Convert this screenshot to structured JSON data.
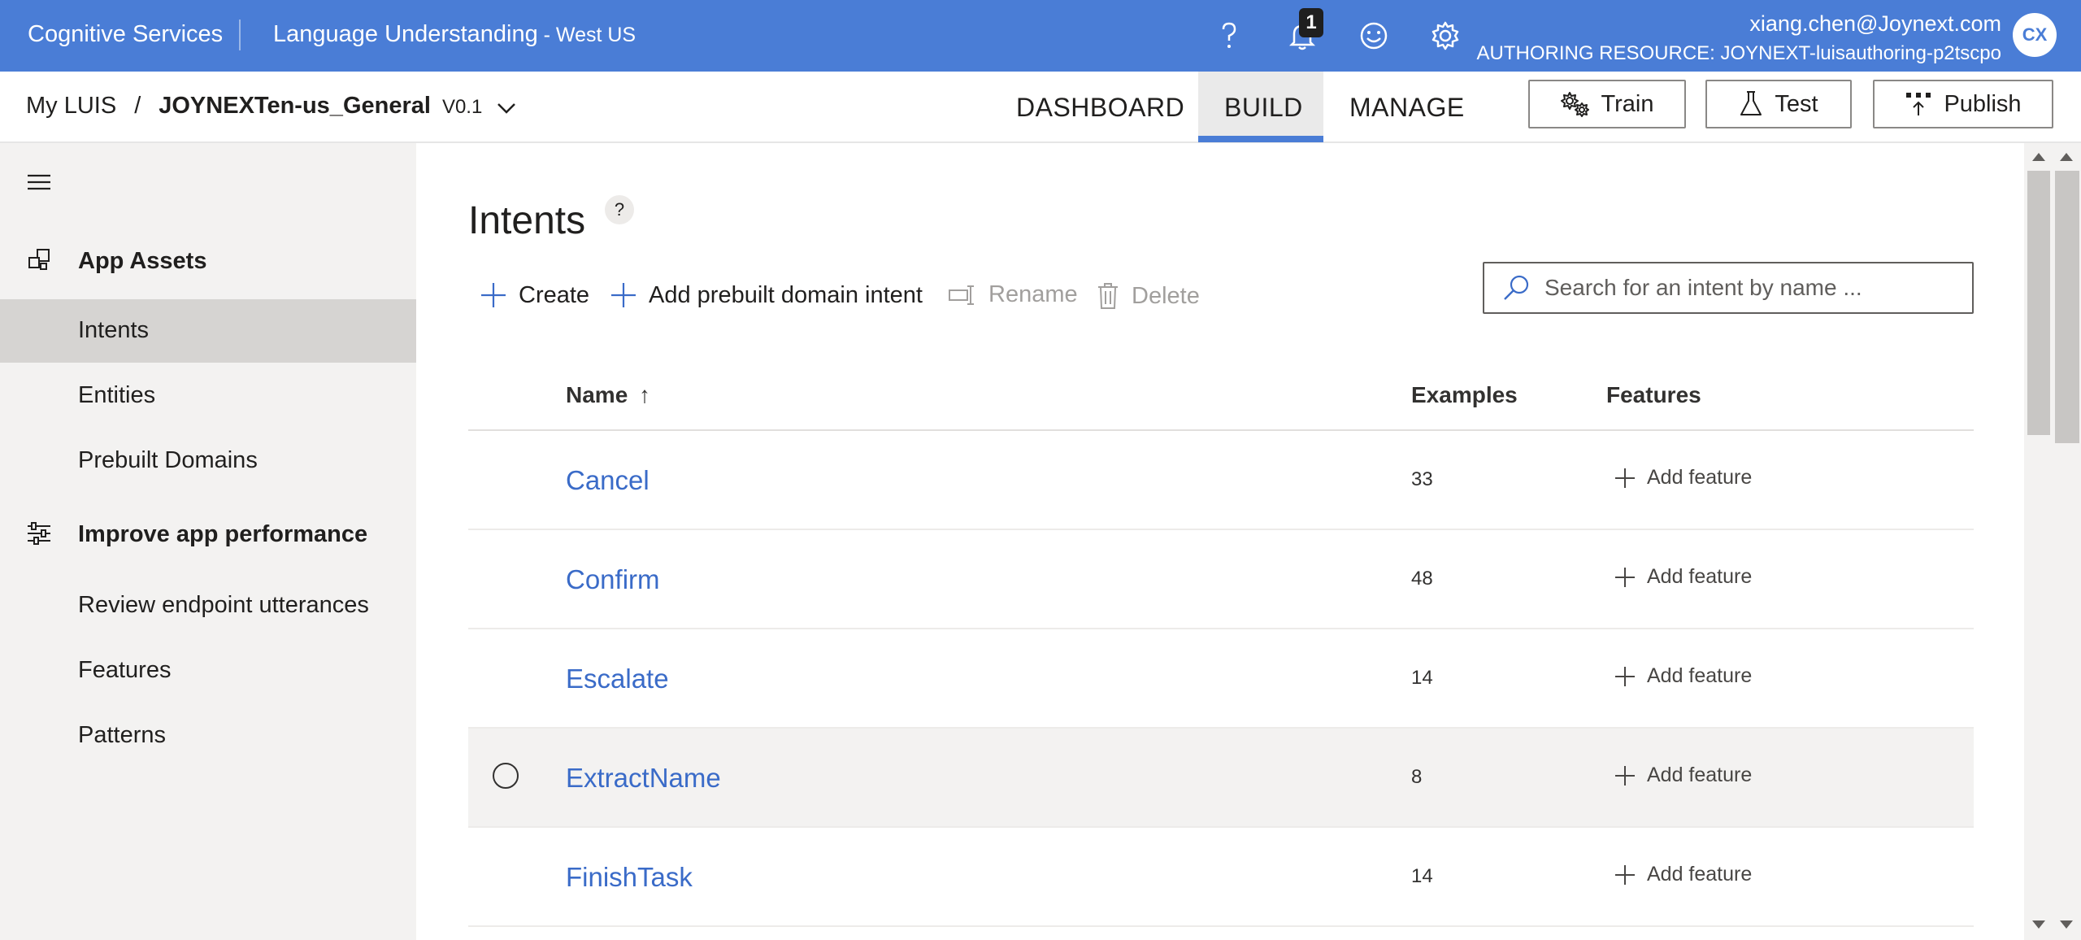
{
  "topbar": {
    "brand": "Cognitive Services",
    "app_name": "Language Understanding",
    "region": " - West US",
    "notification_count": "1",
    "user_email": "xiang.chen@Joynext.com",
    "authoring_resource": "AUTHORING RESOURCE:  JOYNEXT-luisauthoring-p2tscpo",
    "avatar_initials": "CX",
    "icons": [
      "help-icon",
      "bell-icon",
      "feedback-smiley-icon",
      "settings-gear-icon"
    ]
  },
  "subheader": {
    "breadcrumb_root": "My LUIS",
    "breadcrumb_sep": "/",
    "app_selector": "JOYNEXTen-us_General",
    "version": "V0.1",
    "tabs": [
      {
        "label": "DASHBOARD",
        "active": false
      },
      {
        "label": "BUILD",
        "active": true
      },
      {
        "label": "MANAGE",
        "active": false
      }
    ],
    "buttons": {
      "train": "Train",
      "test": "Test",
      "publish": "Publish"
    }
  },
  "sidebar": {
    "sections": [
      {
        "label": "App Assets",
        "icon": "app-assets-icon",
        "items": [
          {
            "label": "Intents",
            "selected": true
          },
          {
            "label": "Entities",
            "selected": false
          },
          {
            "label": "Prebuilt Domains",
            "selected": false
          }
        ]
      },
      {
        "label": "Improve app performance",
        "icon": "sliders-icon",
        "items": [
          {
            "label": "Review endpoint utterances",
            "selected": false
          },
          {
            "label": "Features",
            "selected": false
          },
          {
            "label": "Patterns",
            "selected": false
          }
        ]
      }
    ]
  },
  "main": {
    "title": "Intents",
    "help": "?",
    "toolbar": {
      "create": "Create",
      "add_prebuilt": "Add prebuilt domain intent",
      "rename": "Rename",
      "delete": "Delete"
    },
    "search_placeholder": "Search for an intent by name ...",
    "table": {
      "columns": {
        "name": "Name",
        "sort_indicator": "↑",
        "examples": "Examples",
        "features": "Features"
      },
      "rows": [
        {
          "name": "Cancel",
          "examples": "33",
          "feature_action": "Add feature"
        },
        {
          "name": "Confirm",
          "examples": "48",
          "feature_action": "Add feature"
        },
        {
          "name": "Escalate",
          "examples": "14",
          "feature_action": "Add feature"
        },
        {
          "name": "ExtractName",
          "examples": "8",
          "feature_action": "Add feature",
          "hovered": true
        },
        {
          "name": "FinishTask",
          "examples": "14",
          "feature_action": "Add feature"
        }
      ]
    }
  },
  "colors": {
    "topbar": "#4a7dd6",
    "link": "#3a6bc8",
    "sidebar_bg": "#f3f2f1",
    "sidebar_selected": "#d6d4d2"
  }
}
